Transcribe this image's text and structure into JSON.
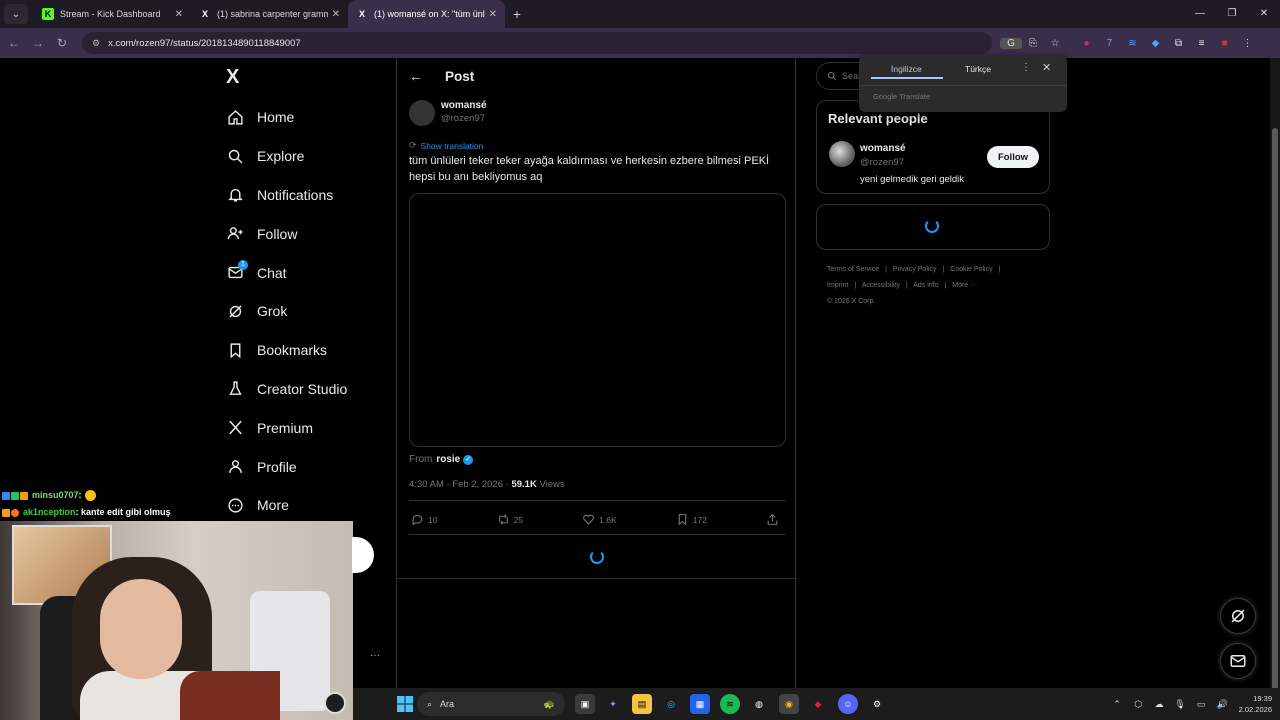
{
  "browser": {
    "tabs": [
      {
        "title": "Stream - Kick Dashboard",
        "favicon": "K"
      },
      {
        "title": "(1) sabrina carpenter grammy - ",
        "favicon": "X"
      },
      {
        "title": "(1) womansé on X: \"tüm ünlüle",
        "favicon": "X"
      }
    ],
    "url": "x.com/rozen97/status/2018134890118849007"
  },
  "sidebar": {
    "logo": "X",
    "items": [
      {
        "label": "Home",
        "icon": "home-icon"
      },
      {
        "label": "Explore",
        "icon": "search-icon"
      },
      {
        "label": "Notifications",
        "icon": "bell-icon"
      },
      {
        "label": "Follow",
        "icon": "person-add-icon"
      },
      {
        "label": "Chat",
        "icon": "mail-icon",
        "badge": "1"
      },
      {
        "label": "Grok",
        "icon": "grok-icon"
      },
      {
        "label": "Bookmarks",
        "icon": "bookmark-icon"
      },
      {
        "label": "Creator Studio",
        "icon": "flask-icon"
      },
      {
        "label": "Premium",
        "icon": "x-icon"
      },
      {
        "label": "Profile",
        "icon": "person-icon"
      },
      {
        "label": "More",
        "icon": "more-circle-icon"
      }
    ]
  },
  "post": {
    "header_title": "Post",
    "author_name": "womansé",
    "author_handle": "@rozen97",
    "show_translation": "Show translation",
    "text": "tüm ünlüleri teker teker ayağa kaldırması ve herkesin ezbere bilmesi PEKİ hepsi bu anı bekliyomus aq",
    "from_label": "From",
    "from_user": "rosie",
    "timestamp": "4:30 AM · Feb 2, 2026 · ",
    "views_count": "59.1K",
    "views_label": " Views",
    "actions": {
      "replies": "10",
      "reposts": "25",
      "likes": "1.6K",
      "bookmarks": "172"
    }
  },
  "right": {
    "search_placeholder": "Search",
    "relevant_title": "Relevant people",
    "person": {
      "name": "womansé",
      "handle": "@rozen97",
      "bio": "yeni gelmedik geri geldik",
      "follow_label": "Follow"
    },
    "footer_line1": [
      "Terms of Service",
      "|",
      "Privacy Policy",
      "|",
      "Cookie Policy",
      "|"
    ],
    "footer_line2": [
      "Imprint",
      "|",
      "Accessibility",
      "|",
      "Ads info",
      "|",
      "More ···"
    ],
    "copyright": "© 2026 X Corp."
  },
  "translate_popup": {
    "tab_source": "İngilizce",
    "tab_target": "Türkçe",
    "brand": "Google Translate"
  },
  "stream_chat": [
    {
      "user": "minsu0707",
      "message": " : "
    },
    {
      "user": "ak1nception",
      "message": " : kante edit gibi olmuş"
    }
  ],
  "taskbar": {
    "search_label": "Ara",
    "time": "19:39",
    "date": "2.02.2026"
  },
  "colors": {
    "accent": "#1d9bf0",
    "border": "#2f3336",
    "muted": "#71767b"
  }
}
